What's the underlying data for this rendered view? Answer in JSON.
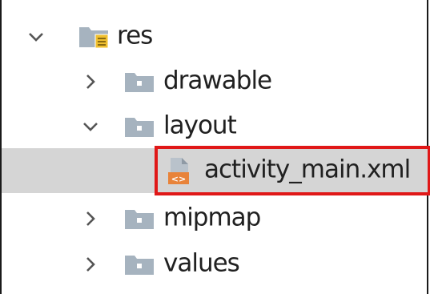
{
  "tree": {
    "root": {
      "label": "res",
      "expanded": true,
      "icon": "resource-folder-icon"
    },
    "items": [
      {
        "label": "drawable",
        "expanded": false,
        "icon": "folder-icon"
      },
      {
        "label": "layout",
        "expanded": true,
        "icon": "folder-icon"
      },
      {
        "label": "activity_main.xml",
        "icon": "layout-xml-file-icon",
        "selected": true
      },
      {
        "label": "mipmap",
        "expanded": false,
        "icon": "folder-icon"
      },
      {
        "label": "values",
        "expanded": false,
        "icon": "folder-icon"
      }
    ]
  },
  "colors": {
    "selection_bg": "#d5d5d5",
    "highlight_border": "#e01818",
    "folder_icon": "#a6b3bf",
    "xml_icon_orange": "#e8833a"
  }
}
